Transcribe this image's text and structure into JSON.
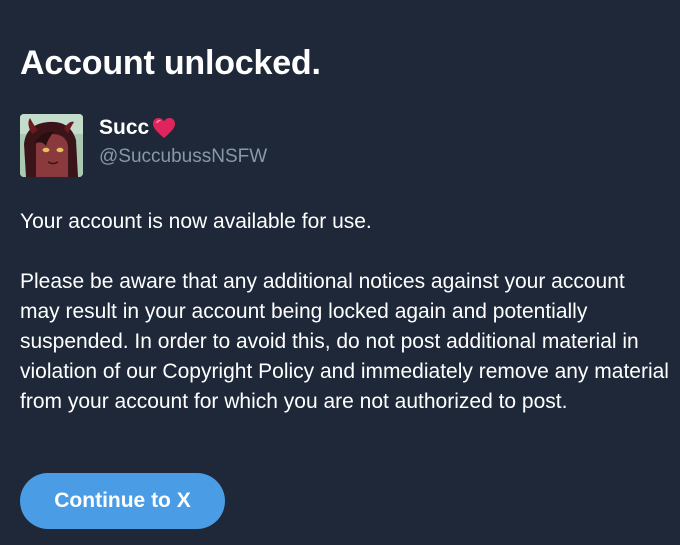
{
  "page": {
    "heading": "Account unlocked."
  },
  "account": {
    "display_name": "Succ",
    "display_name_emoji": "heart-icon",
    "handle": "@SuccubussNSFW"
  },
  "message": {
    "paragraph_1": "Your account is now available for use.",
    "paragraph_2": "Please be aware that any additional notices against your account may result in your account being locked again and potentially suspended. In order to avoid this, do not post additional material in violation of our Copyright Policy and immediately remove any material from your account for which you are not authorized to post."
  },
  "actions": {
    "continue_label": "Continue to X"
  },
  "colors": {
    "background": "#1e2838",
    "primary_text": "#ffffff",
    "secondary_text": "#8899a6",
    "button": "#4a9de5",
    "heart": "#e0245e"
  }
}
